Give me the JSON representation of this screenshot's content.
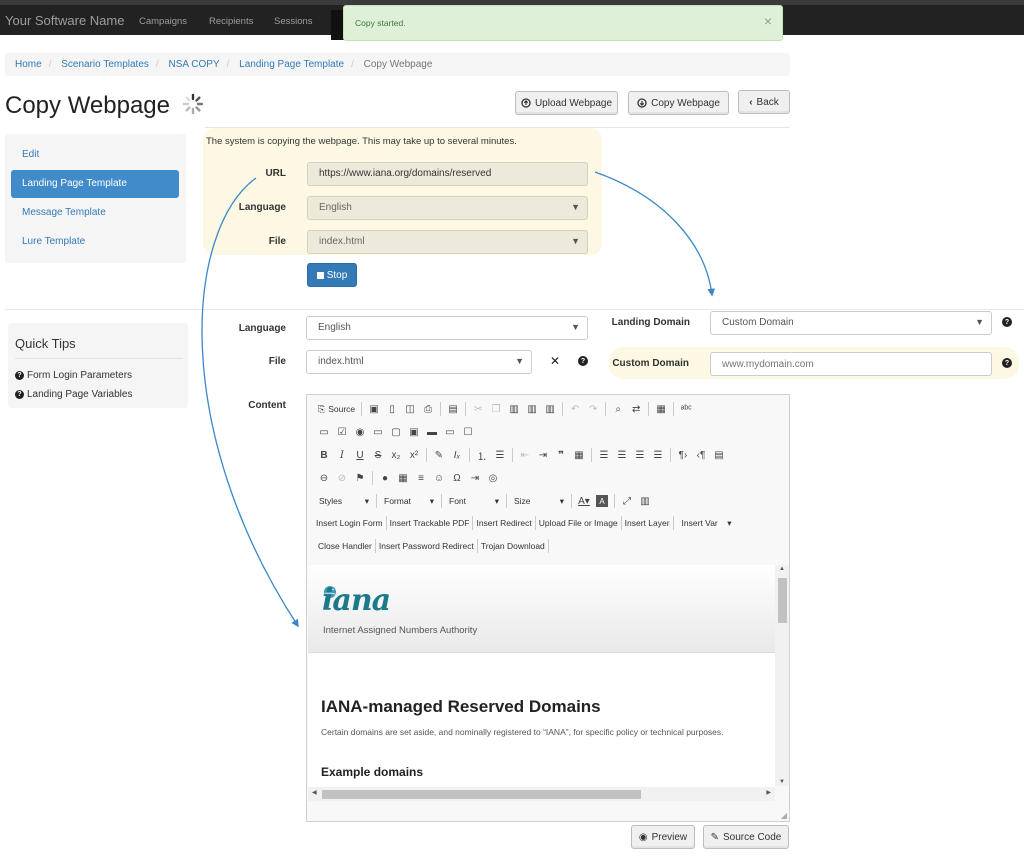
{
  "navbar": {
    "brand": "Your Software Name",
    "links": [
      "Campaigns",
      "Recipients",
      "Sessions"
    ]
  },
  "toast": {
    "message": "Copy started.",
    "close": "×"
  },
  "breadcrumb": {
    "items": [
      "Home",
      "Scenario Templates",
      "NSA COPY",
      "Landing Page Template"
    ],
    "current": "Copy Webpage"
  },
  "page": {
    "title": "Copy Webpage"
  },
  "header_buttons": {
    "upload": "Upload Webpage",
    "copy": "Copy Webpage",
    "back": "Back"
  },
  "sidebar": {
    "items": [
      {
        "label": "Edit"
      },
      {
        "label": "Landing Page Template",
        "active": true
      },
      {
        "label": "Message Template"
      },
      {
        "label": "Lure Template"
      }
    ]
  },
  "quick_tips": {
    "title": "Quick Tips",
    "items": [
      "Form Login Parameters",
      "Landing Page Variables"
    ]
  },
  "copy_panel": {
    "message": "The system is copying the webpage. This may take up to several minutes.",
    "url_label": "URL",
    "url_value": "https://www.iana.org/domains/reserved",
    "language_label": "Language",
    "language_value": "English",
    "file_label": "File",
    "file_value": "index.html",
    "stop_label": "Stop"
  },
  "form": {
    "language_label": "Language",
    "language_value": "English",
    "file_label": "File",
    "file_value": "index.html",
    "landing_domain_label": "Landing Domain",
    "landing_domain_value": "Custom Domain",
    "custom_domain_label": "Custom Domain",
    "custom_domain_placeholder": "www.mydomain.com",
    "content_label": "Content"
  },
  "editor": {
    "source_label": "Source",
    "dropdowns": [
      "Styles",
      "Format",
      "Font",
      "Size"
    ],
    "custom_buttons_row1": [
      "Insert Login Form",
      "Insert Trackable PDF",
      "Insert Redirect",
      "Upload File or Image",
      "Insert Layer"
    ],
    "insert_var": "Insert Var",
    "custom_buttons_row2": [
      "Close Handler",
      "Insert Password Redirect",
      "Trojan Download"
    ]
  },
  "preview_page": {
    "logo": "iana",
    "logo_subtitle": "Internet Assigned Numbers Authority",
    "heading": "IANA-managed Reserved Domains",
    "paragraph": "Certain domains are set aside, and nominally registered to “IANA”, for specific policy or technical purposes.",
    "subheading": "Example domains"
  },
  "footer_buttons": {
    "preview": "Preview",
    "source_code": "Source Code"
  },
  "colors": {
    "navbar": "#222222",
    "toast_bg": "#dff0d8",
    "highlight_bg": "#fcf8e3",
    "primary": "#337ab7",
    "active_nav": "#428bca",
    "annotation_arrow": "#3a88c8"
  }
}
